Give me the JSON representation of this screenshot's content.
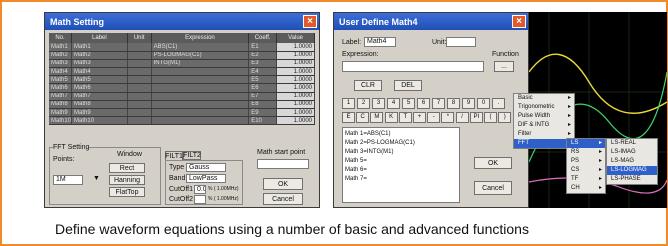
{
  "caption": "Define waveform equations using a number of basic and advanced functions",
  "math_setting": {
    "title": "Math Setting",
    "columns": [
      "No.",
      "Label",
      "Unit",
      "Expression",
      "Coeff.",
      "Value"
    ],
    "rows": [
      {
        "no": "Math1",
        "label": "Math1",
        "expr": "ABS(C1)",
        "coef": "E1",
        "val": "1.0000"
      },
      {
        "no": "Math2",
        "label": "Math2",
        "expr": "PS-LOGMAG(C1)",
        "coef": "E2",
        "val": "1.0000"
      },
      {
        "no": "Math3",
        "label": "Math3",
        "expr": "INTG(M1)",
        "coef": "E3",
        "val": "1.0000"
      },
      {
        "no": "Math4",
        "label": "Math4",
        "expr": "",
        "coef": "E4",
        "val": "1.0000"
      },
      {
        "no": "Math5",
        "label": "Math5",
        "expr": "",
        "coef": "E5",
        "val": "1.0000"
      },
      {
        "no": "Math6",
        "label": "Math6",
        "expr": "",
        "coef": "E6",
        "val": "1.0000"
      },
      {
        "no": "Math7",
        "label": "Math7",
        "expr": "",
        "coef": "E7",
        "val": "1.0000"
      },
      {
        "no": "Math8",
        "label": "Math8",
        "expr": "",
        "coef": "E8",
        "val": "1.0000"
      },
      {
        "no": "Math9",
        "label": "Math9",
        "expr": "",
        "coef": "E9",
        "val": "1.0000"
      },
      {
        "no": "Math10",
        "label": "Math10",
        "expr": "",
        "coef": "E10",
        "val": "1.0000"
      }
    ],
    "fft_setting_label": "FFT Setting",
    "points_label": "Points:",
    "points_value": "1M",
    "window_label": "Window",
    "window_buttons": [
      "Rect",
      "Hanning",
      "FlatTop"
    ],
    "tabs": [
      "FILT1",
      "FILT2"
    ],
    "type_label": "Type",
    "type_value": "Gauss",
    "band_label": "Band",
    "band_value": "LowPass",
    "cutoff1_label": "CutOff1",
    "cutoff1_value": "0.0",
    "cutoff1_unit": "% ( 1.00MHz)",
    "cutoff2_label": "CutOff2",
    "cutoff2_value": "",
    "cutoff2_unit": "% ( 1.00MHz)",
    "math_start_label": "Math start point",
    "ok": "OK",
    "cancel": "Cancel"
  },
  "user_define": {
    "title": "User Define Math4",
    "label_caption": "Label:",
    "label_value": "Math4",
    "unit_caption": "Unit:",
    "expression_caption": "Expression:",
    "function_caption": "Function",
    "function_button": "...",
    "clr": "CLR",
    "del": "DEL",
    "digits": [
      "1",
      "2",
      "3",
      "4",
      "5",
      "6",
      "7",
      "8",
      "9",
      "0",
      "."
    ],
    "ops": [
      "E",
      "C",
      "M",
      "K",
      "T",
      "+",
      "-",
      "*",
      "/",
      "PI",
      "(",
      ")"
    ],
    "list": [
      "Math 1=ABS(C1)",
      "Math 2=PS-LOGMAG(C1)",
      "Math 3=INTG(M1)",
      "Math 5=",
      "Math 6=",
      "Math 7="
    ],
    "ok": "OK",
    "cancel": "Cancel"
  },
  "menus": {
    "main": [
      "Basic",
      "Trigonometric",
      "Pulse Width",
      "DIF & INTG",
      "Filter",
      "FFT"
    ],
    "fft": [
      "LS",
      "RS",
      "PS",
      "CS",
      "TF",
      "CH"
    ],
    "ls": [
      "LS-REAL",
      "LS-IMAG",
      "LS-MAG",
      "LS-LOGMAG",
      "LS-PHASE"
    ]
  }
}
